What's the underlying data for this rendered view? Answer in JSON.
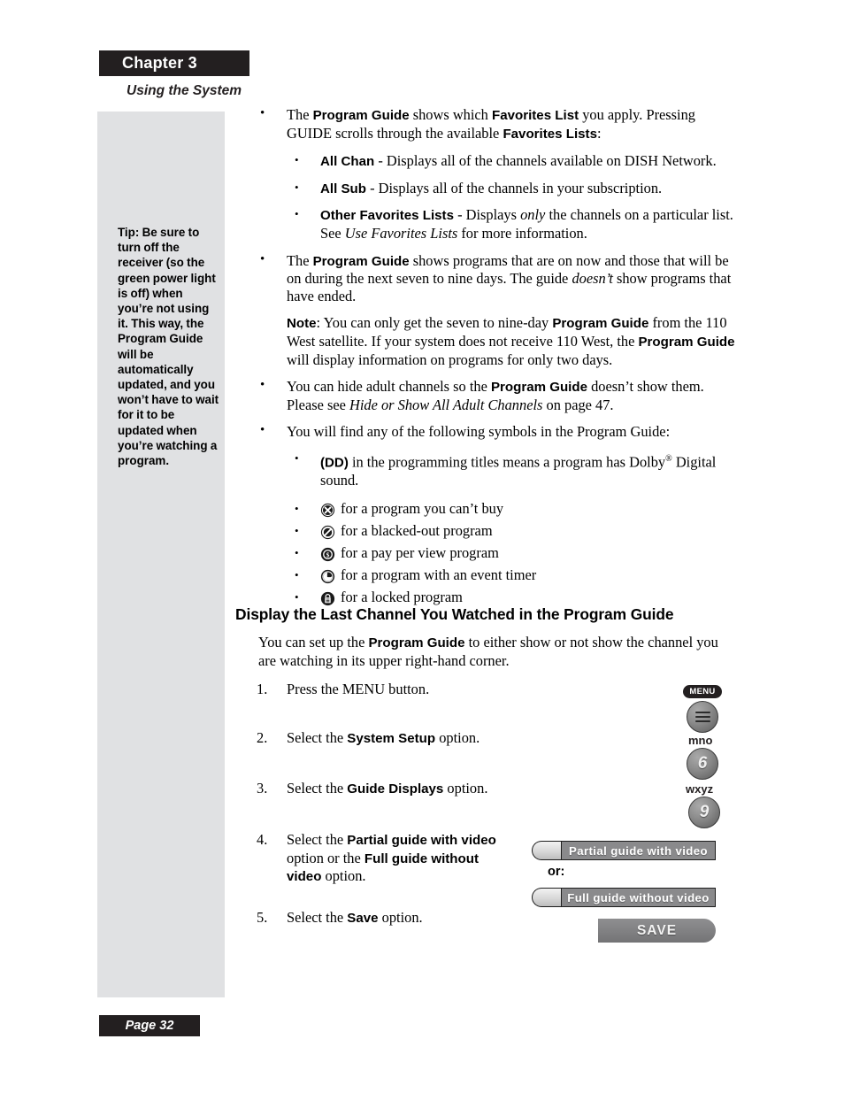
{
  "header": {
    "chapter_label": "Chapter 3",
    "running_head": "Using the System"
  },
  "sidebar": {
    "tip_text": "Tip: Be sure to turn off the receiver (so the green power light is off) when you’re not using it. This way, the Program Guide will be automatically updated, and you won’t have to wait for it to be updated when you’re watching a program."
  },
  "bullets": {
    "favorites_intro_1": "The ",
    "favorites_intro_b1": "Program Guide",
    "favorites_intro_2": " shows which ",
    "favorites_intro_b2": "Favorites List",
    "favorites_intro_3": " you apply. Pressing GUIDE scrolls through the available ",
    "favorites_intro_b3": "Favorites Lists",
    "favorites_intro_4": ":",
    "all_chan_term": "All Chan",
    "all_chan_desc": " - Displays all of the channels available on DISH Network.",
    "all_sub_term": "All Sub",
    "all_sub_desc": " - Displays all of the channels in your subscription.",
    "other_fav_term": "Other Favorites Lists",
    "other_fav_desc_1": " - Displays ",
    "other_fav_italic_1": "only",
    "other_fav_desc_2": " the channels on a particular list. See ",
    "other_fav_italic_2": "Use Favorites Lists",
    "other_fav_desc_3": " for more information.",
    "days_1": "The ",
    "days_b1": "Program Guide",
    "days_2": " shows programs that are on now and those that will be on during the next seven to nine days. The guide ",
    "days_italic": "doesn’t",
    "days_3": " show programs that have ended.",
    "note_label": "Note",
    "note_1": ": You can only get the seven to nine-day ",
    "note_b1": "Program Guide",
    "note_2": " from the 110 West satellite. If your system does not receive 110 West, the ",
    "note_b2": "Program Guide",
    "note_3": " will display information on programs for only two days.",
    "adult_1": "You can hide adult channels so the ",
    "adult_b1": "Program Guide",
    "adult_2": " doesn’t show them. Please see ",
    "adult_italic": "Hide or Show All Adult Channels",
    "adult_3": " on page 47.",
    "symbols_intro": "You will find any of the following symbols in the Program Guide:",
    "dd_term": "(DD)",
    "dd_desc_1": " in the programming titles means a program has Dolby",
    "dd_sup": "®",
    "dd_desc_2": " Digital sound."
  },
  "symbols": [
    {
      "icon": "circle-x-icon",
      "label": "for a program you can’t buy"
    },
    {
      "icon": "circle-slash-icon",
      "label": "for a blacked-out program"
    },
    {
      "icon": "circle-dollar-icon",
      "label": "for a pay per view program"
    },
    {
      "icon": "circle-clock-icon",
      "label": "for a program with an event timer"
    },
    {
      "icon": "padlock-icon",
      "label": "for a locked program"
    }
  ],
  "section": {
    "heading": "Display the Last Channel You Watched in the Program Guide",
    "intro_1": "You can set up the ",
    "intro_b1": "Program Guide",
    "intro_2": " to either show or not show the channel you are watching in its upper right-hand corner."
  },
  "steps": {
    "s1_num": "1.",
    "s1_1": "Press the MENU button.",
    "s2_num": "2.",
    "s2_1": "Select the ",
    "s2_b": "System Setup",
    "s2_2": " option.",
    "s3_num": "3.",
    "s3_1": "Select the ",
    "s3_b": "Guide Displays",
    "s3_2": " option.",
    "s4_num": "4.",
    "s4_1": "Select the ",
    "s4_b1": "Partial guide with video",
    "s4_2": " option or the ",
    "s4_b2": "Full guide without video",
    "s4_3": " option.",
    "s5_num": "5.",
    "s5_1": "Select the ",
    "s5_b": "Save",
    "s5_2": " option."
  },
  "remote": {
    "menu_pill_label": "MENU",
    "key6_letters": "mno",
    "key6_digit": "6",
    "key9_letters": "wxyz",
    "key9_digit": "9"
  },
  "onscreen": {
    "partial_label": "Partial guide with video",
    "or_label": "or:",
    "full_label": "Full guide without video",
    "save_label": "SAVE"
  },
  "footer": {
    "page_label": "Page 32"
  },
  "colors": {
    "tab_dark": "#231f20",
    "sidebar_gray": "#e0e1e3",
    "bar_gray": "#8a8a8c"
  }
}
